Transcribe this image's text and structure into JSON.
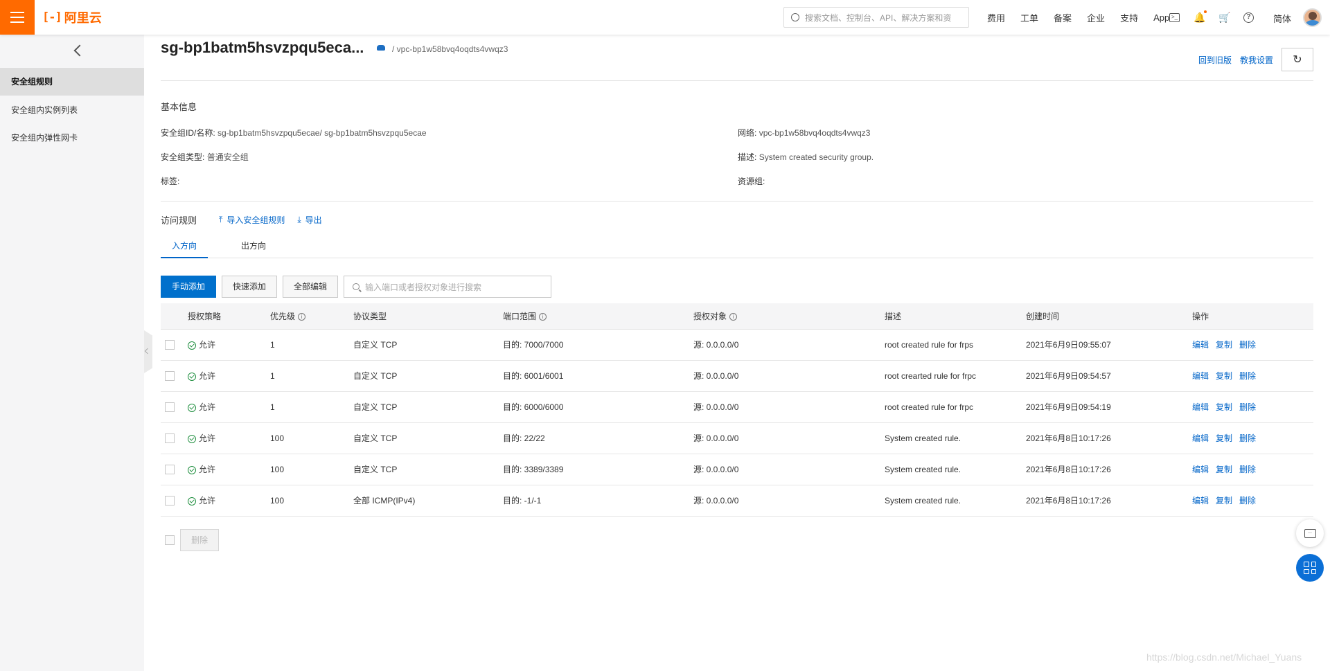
{
  "topbar": {
    "logo_text": "阿里云",
    "logo_mark": "[-]",
    "search_placeholder": "搜索文档、控制台、API、解决方案和资",
    "links": [
      "费用",
      "工单",
      "备案",
      "企业",
      "支持",
      "App"
    ],
    "lang": "简体"
  },
  "sidebar": {
    "items": [
      "安全组规则",
      "安全组内实例列表",
      "安全组内弹性网卡"
    ]
  },
  "header": {
    "title": "sg-bp1batm5hsvzpqu5eca...",
    "subtitle": "/ vpc-bp1w58bvq4oqdts4vwqz3",
    "back_old": "回到旧版",
    "tutorial": "教我设置"
  },
  "basic_info": {
    "section_title": "基本信息",
    "id_name_label": "安全组ID/名称:",
    "id_name_value": "sg-bp1batm5hsvzpqu5ecae/ sg-bp1batm5hsvzpqu5ecae",
    "type_label": "安全组类型:",
    "type_value": "普通安全组",
    "tag_label": "标签:",
    "network_label": "网络:",
    "network_value": "vpc-bp1w58bvq4oqdts4vwqz3",
    "desc_label": "描述:",
    "desc_value": "System created security group.",
    "rg_label": "资源组:"
  },
  "rules": {
    "title": "访问规则",
    "import_label": "导入安全组规则",
    "export_label": "导出",
    "tabs": [
      "入方向",
      "出方向"
    ],
    "manual_add": "手动添加",
    "quick_add": "快速添加",
    "edit_all": "全部编辑",
    "search_placeholder": "输入端口或者授权对象进行搜索",
    "columns": [
      "授权策略",
      "优先级",
      "协议类型",
      "端口范围",
      "授权对象",
      "描述",
      "创建时间",
      "操作"
    ],
    "rows": [
      {
        "policy": "允许",
        "priority": "1",
        "protocol": "自定义 TCP",
        "port": "目的: 7000/7000",
        "object": "源: 0.0.0.0/0",
        "desc": "root created rule for frps",
        "time": "2021年6月9日09:55:07"
      },
      {
        "policy": "允许",
        "priority": "1",
        "protocol": "自定义 TCP",
        "port": "目的: 6001/6001",
        "object": "源: 0.0.0.0/0",
        "desc": "root crearted rule for frpc",
        "time": "2021年6月9日09:54:57"
      },
      {
        "policy": "允许",
        "priority": "1",
        "protocol": "自定义 TCP",
        "port": "目的: 6000/6000",
        "object": "源: 0.0.0.0/0",
        "desc": "root created rule for frpc",
        "time": "2021年6月9日09:54:19"
      },
      {
        "policy": "允许",
        "priority": "100",
        "protocol": "自定义 TCP",
        "port": "目的: 22/22",
        "object": "源: 0.0.0.0/0",
        "desc": "System created rule.",
        "time": "2021年6月8日10:17:26"
      },
      {
        "policy": "允许",
        "priority": "100",
        "protocol": "自定义 TCP",
        "port": "目的: 3389/3389",
        "object": "源: 0.0.0.0/0",
        "desc": "System created rule.",
        "time": "2021年6月8日10:17:26"
      },
      {
        "policy": "允许",
        "priority": "100",
        "protocol": "全部 ICMP(IPv4)",
        "port": "目的: -1/-1",
        "object": "源: 0.0.0.0/0",
        "desc": "System created rule.",
        "time": "2021年6月8日10:17:26"
      }
    ],
    "ops": [
      "编辑",
      "复制",
      "删除"
    ],
    "delete_label": "删除"
  },
  "watermark": "https://blog.csdn.net/Michael_Yuans",
  "colors": {
    "brand": "#ff6a00",
    "primary": "#0070cc",
    "link": "#0064c8",
    "allow": "#1e8e3e"
  }
}
